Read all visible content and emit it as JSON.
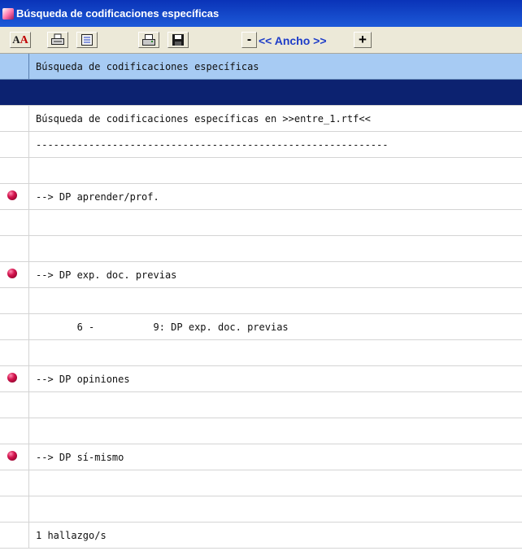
{
  "window": {
    "title": "Búsqueda de codificaciones específicas"
  },
  "toolbar": {
    "buttons": [
      {
        "name": "font-button",
        "icon": "font-aa-icon"
      },
      {
        "name": "print-button",
        "icon": "printer-icon"
      },
      {
        "name": "print-preview-button",
        "icon": "document-print-icon"
      },
      {
        "name": "print-setup-button",
        "icon": "printer-setup-icon"
      },
      {
        "name": "save-button",
        "icon": "floppy-disk-icon"
      }
    ],
    "minus_label": "-",
    "ancho_label": "<< Ancho >>",
    "plus_label": "+"
  },
  "rows": [
    {
      "text": "Búsqueda de codificaciones específicas",
      "type": "header",
      "bullet": false
    },
    {
      "text": "",
      "type": "selected",
      "bullet": false
    },
    {
      "text": "Búsqueda de codificaciones específicas en >>entre_1.rtf<<",
      "type": "normal",
      "bullet": false
    },
    {
      "text": "------------------------------------------------------------",
      "type": "normal",
      "bullet": false
    },
    {
      "text": "",
      "type": "normal",
      "bullet": false
    },
    {
      "text": "--> DP aprender/prof.",
      "type": "normal",
      "bullet": true
    },
    {
      "text": "",
      "type": "normal",
      "bullet": false
    },
    {
      "text": "",
      "type": "normal",
      "bullet": false
    },
    {
      "text": "--> DP exp. doc. previas",
      "type": "normal",
      "bullet": true
    },
    {
      "text": "",
      "type": "normal",
      "bullet": false
    },
    {
      "text": "       6 -          9: DP exp. doc. previas",
      "type": "normal",
      "bullet": false
    },
    {
      "text": "",
      "type": "normal",
      "bullet": false
    },
    {
      "text": "--> DP opiniones",
      "type": "normal",
      "bullet": true
    },
    {
      "text": "",
      "type": "normal",
      "bullet": false
    },
    {
      "text": "",
      "type": "normal",
      "bullet": false
    },
    {
      "text": "--> DP sí-mismo",
      "type": "normal",
      "bullet": true
    },
    {
      "text": "",
      "type": "normal",
      "bullet": false
    },
    {
      "text": "",
      "type": "normal",
      "bullet": false
    },
    {
      "text": "1 hallazgo/s",
      "type": "normal",
      "bullet": false
    }
  ],
  "colors": {
    "header_row": "#a7cbf3",
    "selected_row": "#0c2270",
    "bullet": "#d3134d",
    "ancho_text": "#1d3cc8"
  }
}
